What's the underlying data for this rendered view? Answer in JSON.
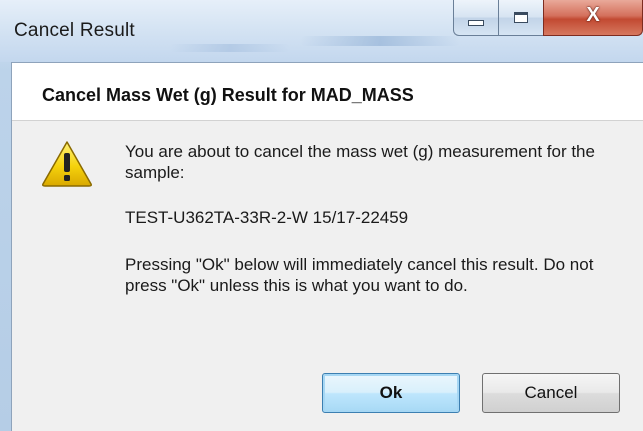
{
  "window": {
    "title": "Cancel Result",
    "minimize_glyph": "minimize",
    "maximize_glyph": "maximize",
    "close_glyph": "X"
  },
  "dialog": {
    "header": "Cancel Mass Wet (g) Result for MAD_MASS",
    "icon": "warning-icon",
    "message_intro": "You are about to cancel the mass wet (g) measurement for the sample:",
    "sample_id": "TEST-U362TA-33R-2-W 15/17-22459",
    "message_warning": "Pressing \"Ok\" below will immediately cancel this result.  Do not press \"Ok\" unless this is what you want to do."
  },
  "buttons": {
    "ok_label": "Ok",
    "cancel_label": "Cancel"
  },
  "colors": {
    "title_bar": "#d4e3f3",
    "dialog_background": "#f0f0f0",
    "close_button": "#c24a32",
    "default_button_border": "#3c7fb1",
    "warning_yellow": "#f5d20c"
  }
}
